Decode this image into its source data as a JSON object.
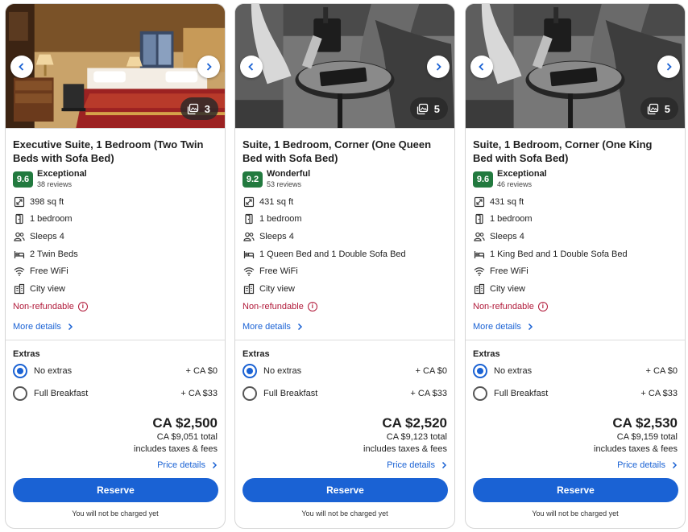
{
  "extras_label": "Extras",
  "reserve_label": "Reserve",
  "not_charged": "You will not be charged yet",
  "price_details_label": "Price details",
  "more_details_label": "More details",
  "nonrefundable_label": "Non-refundable",
  "accent_color": "#1a62d4",
  "rating_color": "#227a3f",
  "cards": [
    {
      "title": "Executive Suite, 1 Bedroom (Two Twin Beds with Sofa Bed)",
      "photo_count": "3",
      "photo_style": "color",
      "score": "9.6",
      "rating_label": "Exceptional",
      "reviews": "38 reviews",
      "features": [
        "398 sq ft",
        "1 bedroom",
        "Sleeps 4",
        "2 Twin Beds",
        "Free WiFi",
        "City view"
      ],
      "extras": [
        {
          "label": "No extras",
          "price": "+ CA $0",
          "selected": true
        },
        {
          "label": "Full Breakfast",
          "price": "+ CA $33",
          "selected": false
        }
      ],
      "price": "CA $2,500",
      "total": "CA $9,051 total",
      "note": "includes taxes & fees"
    },
    {
      "title": "Suite, 1 Bedroom, Corner (One Queen Bed with Sofa Bed)",
      "photo_count": "5",
      "photo_style": "bw",
      "score": "9.2",
      "rating_label": "Wonderful",
      "reviews": "53 reviews",
      "features": [
        "431 sq ft",
        "1 bedroom",
        "Sleeps 4",
        "1 Queen Bed and 1 Double Sofa Bed",
        "Free WiFi",
        "City view"
      ],
      "extras": [
        {
          "label": "No extras",
          "price": "+ CA $0",
          "selected": true
        },
        {
          "label": "Full Breakfast",
          "price": "+ CA $33",
          "selected": false
        }
      ],
      "price": "CA $2,520",
      "total": "CA $9,123 total",
      "note": "includes taxes & fees"
    },
    {
      "title": "Suite, 1 Bedroom, Corner (One King Bed with Sofa Bed)",
      "photo_count": "5",
      "photo_style": "bw",
      "score": "9.6",
      "rating_label": "Exceptional",
      "reviews": "46 reviews",
      "features": [
        "431 sq ft",
        "1 bedroom",
        "Sleeps 4",
        "1 King Bed and 1 Double Sofa Bed",
        "Free WiFi",
        "City view"
      ],
      "extras": [
        {
          "label": "No extras",
          "price": "+ CA $0",
          "selected": true
        },
        {
          "label": "Full Breakfast",
          "price": "+ CA $33",
          "selected": false
        }
      ],
      "price": "CA $2,530",
      "total": "CA $9,159 total",
      "note": "includes taxes & fees"
    }
  ]
}
